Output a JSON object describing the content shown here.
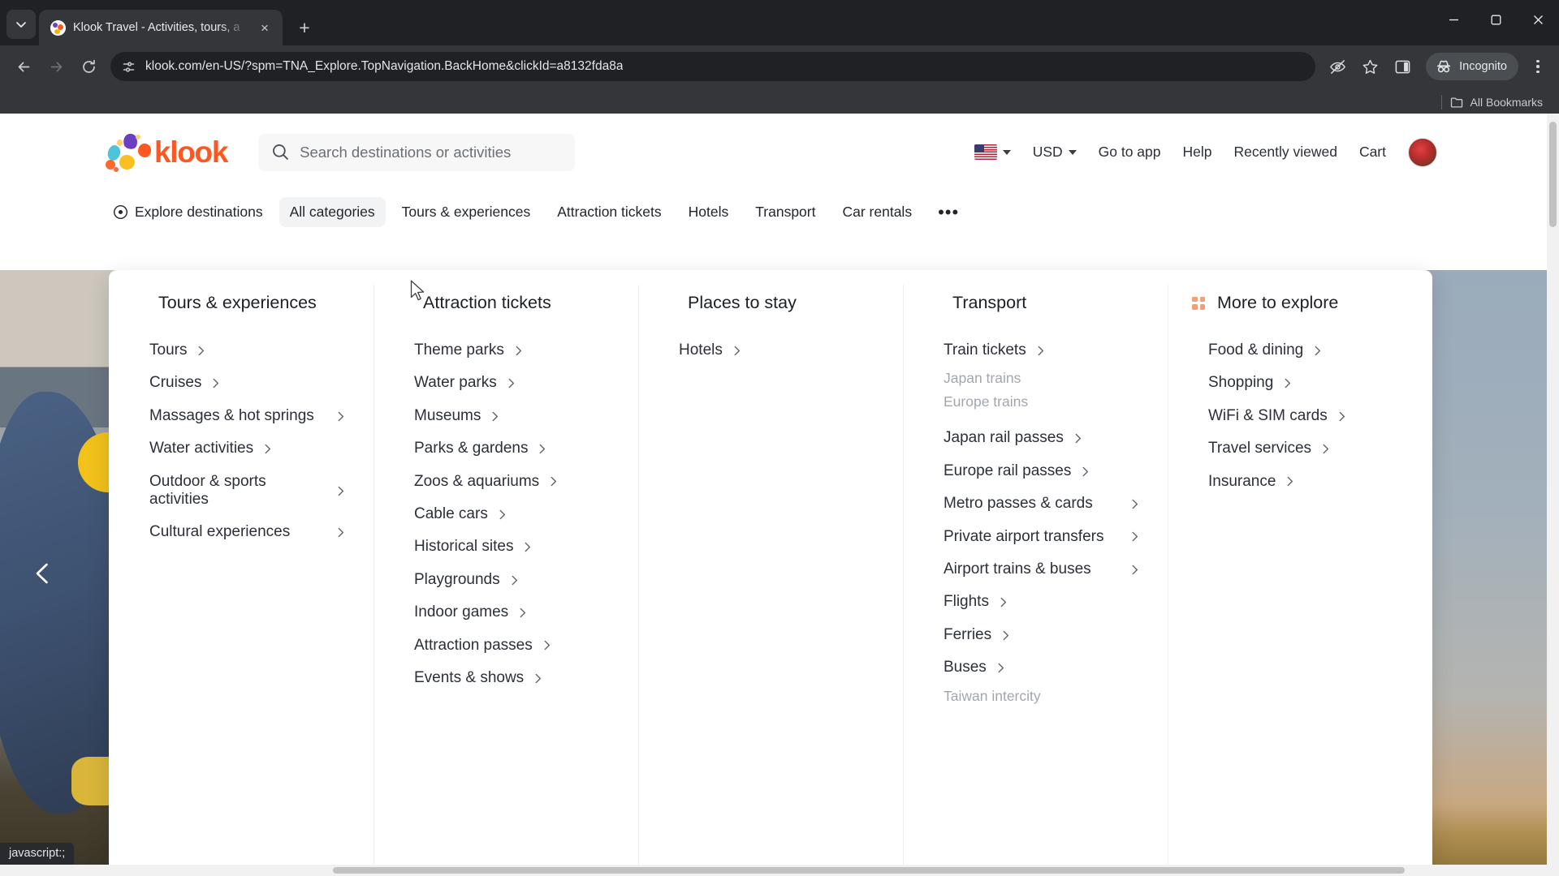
{
  "browser": {
    "tab": {
      "title": "Klook Travel - Activities, tours, a",
      "favicon": "klook-favicon",
      "close_label": "×"
    },
    "new_tab_label": "+",
    "window_controls": {
      "minimize": "minimize-icon",
      "maximize": "maximize-icon",
      "close": "close-icon"
    },
    "toolbar": {
      "back": "back-arrow-icon",
      "forward": "forward-arrow-icon",
      "reload": "reload-icon",
      "site_info": "site-settings-icon",
      "url": "klook.com/en-US/?spm=TNA_Explore.TopNavigation.BackHome&clickId=a8132fda8a",
      "eye_off": "eye-off-icon",
      "bookmark": "star-icon",
      "side_panel": "side-panel-icon",
      "incognito_label": "Incognito",
      "menu": "three-dot-menu-icon"
    },
    "bookmarks_bar": {
      "label": "All Bookmarks",
      "icon": "folder-icon"
    },
    "status_text": "javascript:;"
  },
  "site": {
    "logo_text": "klook",
    "search": {
      "placeholder": "Search destinations or activities",
      "icon": "search-icon"
    },
    "header_right": {
      "flag": "us-flag-icon",
      "currency": "USD",
      "links": [
        "Go to app",
        "Help",
        "Recently viewed",
        "Cart"
      ],
      "avatar": "user-avatar"
    },
    "nav": {
      "explore": "Explore destinations",
      "items": [
        {
          "label": "All categories",
          "active": true
        },
        {
          "label": "Tours & experiences",
          "active": false
        },
        {
          "label": "Attraction tickets",
          "active": false
        },
        {
          "label": "Hotels",
          "active": false
        },
        {
          "label": "Transport",
          "active": false
        },
        {
          "label": "Car rentals",
          "active": false
        }
      ],
      "more": "•••"
    },
    "carousel": {
      "prev": "chevron-left-icon",
      "next": "chevron-right-icon"
    },
    "mega_menu": {
      "columns": [
        {
          "icon": "hot-air-balloon-icon",
          "title": "Tours & experiences",
          "links": [
            {
              "label": "Tours",
              "chevron": true
            },
            {
              "label": "Cruises",
              "chevron": true
            },
            {
              "label": "Massages & hot springs",
              "chevron": true
            },
            {
              "label": "Water activities",
              "chevron": true
            },
            {
              "label": "Outdoor & sports activities",
              "chevron": true
            },
            {
              "label": "Cultural experiences",
              "chevron": true
            }
          ]
        },
        {
          "icon": "ticket-icon",
          "title": "Attraction tickets",
          "links": [
            {
              "label": "Theme parks",
              "chevron": true
            },
            {
              "label": "Water parks",
              "chevron": true
            },
            {
              "label": "Museums",
              "chevron": true
            },
            {
              "label": "Parks & gardens",
              "chevron": true
            },
            {
              "label": "Zoos & aquariums",
              "chevron": true
            },
            {
              "label": "Cable cars",
              "chevron": true
            },
            {
              "label": "Historical sites",
              "chevron": true
            },
            {
              "label": "Playgrounds",
              "chevron": true
            },
            {
              "label": "Indoor games",
              "chevron": true
            },
            {
              "label": "Attraction passes",
              "chevron": true
            },
            {
              "label": "Events & shows",
              "chevron": true
            }
          ]
        },
        {
          "icon": "hotel-icon",
          "title": "Places to stay",
          "links": [
            {
              "label": "Hotels",
              "chevron": true
            }
          ]
        },
        {
          "icon": "train-icon",
          "title": "Transport",
          "links": [
            {
              "label": "Train tickets",
              "chevron": true,
              "subs": [
                "Japan trains",
                "Europe trains"
              ]
            },
            {
              "label": "Japan rail passes",
              "chevron": true
            },
            {
              "label": "Europe rail passes",
              "chevron": true
            },
            {
              "label": "Metro passes & cards",
              "chevron": true
            },
            {
              "label": "Private airport transfers",
              "chevron": true
            },
            {
              "label": "Airport trains & buses",
              "chevron": true
            },
            {
              "label": "Flights",
              "chevron": true
            },
            {
              "label": "Ferries",
              "chevron": true
            },
            {
              "label": "Buses",
              "chevron": true,
              "subs": [
                "Taiwan intercity"
              ]
            }
          ]
        },
        {
          "icon": "grid-icon",
          "title": "More to explore",
          "links": [
            {
              "label": "Food & dining",
              "chevron": true
            },
            {
              "label": "Shopping",
              "chevron": true
            },
            {
              "label": "WiFi & SIM cards",
              "chevron": true
            },
            {
              "label": "Travel services",
              "chevron": true
            },
            {
              "label": "Insurance",
              "chevron": true
            }
          ]
        }
      ]
    }
  },
  "colors": {
    "brand": "#ff5722",
    "nav_active_bg": "#f2f3f5",
    "chrome_bg": "#202124",
    "toolbar_bg": "#35363a"
  }
}
